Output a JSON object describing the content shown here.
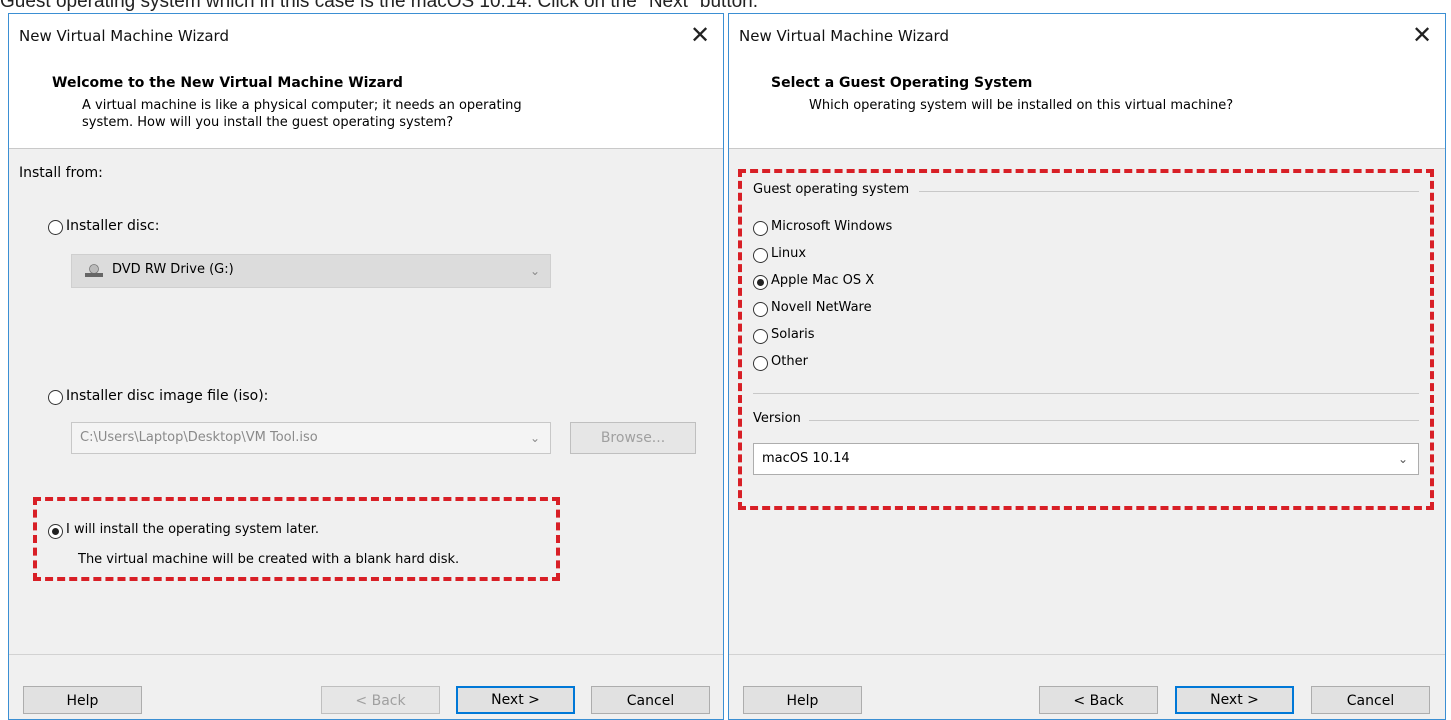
{
  "caption": "Guest operating system which in this case is the macOS 10.14. Click on the \"Next\" button.",
  "left": {
    "title": "New Virtual Machine Wizard",
    "header_title": "Welcome to the New Virtual Machine Wizard",
    "header_desc_line1": "A virtual machine is like a physical computer; it needs an operating",
    "header_desc_line2": "system. How will you install the guest operating system?",
    "install_from": "Install from:",
    "installer_disc": "Installer disc:",
    "dvd_drive": "DVD RW Drive (G:)",
    "iso_option": "Installer disc image file (iso):",
    "iso_path": "C:\\Users\\Laptop\\Desktop\\VM Tool.iso",
    "browse": "Browse...",
    "later_option": "I will install the operating system later.",
    "later_desc": "The virtual machine will be created with a blank hard disk.",
    "selected_option": "I will install the operating system later.",
    "buttons": {
      "help": "Help",
      "back": "< Back",
      "next": "Next >",
      "cancel": "Cancel"
    }
  },
  "right": {
    "title": "New Virtual Machine Wizard",
    "header_title": "Select a Guest Operating System",
    "header_desc": "Which operating system will be installed on this virtual machine?",
    "group_label": "Guest operating system",
    "os_options": [
      "Microsoft Windows",
      "Linux",
      "Apple Mac OS X",
      "Novell NetWare",
      "Solaris",
      "Other"
    ],
    "selected_os": "Apple Mac OS X",
    "version_label": "Version",
    "version_value": "macOS 10.14",
    "buttons": {
      "help": "Help",
      "back": "< Back",
      "next": "Next >",
      "cancel": "Cancel"
    }
  },
  "colors": {
    "highlight": "#d81f26",
    "accent": "#0078d7",
    "window_border": "#3b8fd3"
  }
}
